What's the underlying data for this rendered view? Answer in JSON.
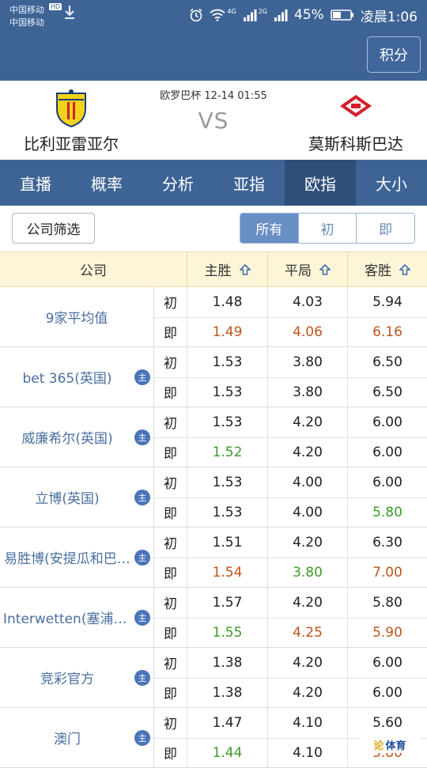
{
  "status": {
    "carrier1": "中国移动",
    "carrier2": "中国移动",
    "hd_badge": "HD",
    "battery": "45%",
    "time": "凌晨1:06",
    "net1": "4G",
    "net2": "2G"
  },
  "appbar": {
    "points_button": "积分"
  },
  "match": {
    "competition_time": "欧罗巴杯 12-14 01:55",
    "vs": "VS",
    "home": "比利亚雷亚尔",
    "away": "莫斯科斯巴达"
  },
  "tabs": [
    "直播",
    "概率",
    "分析",
    "亚指",
    "欧指",
    "大小"
  ],
  "active_tab": "欧指",
  "filter": {
    "company_filter": "公司筛选",
    "segments": [
      "所有",
      "初",
      "即"
    ],
    "active_segment": "所有"
  },
  "table": {
    "headers": {
      "company": "公司",
      "home": "主胜",
      "draw": "平局",
      "away": "客胜"
    },
    "kind_initial": "初",
    "kind_live": "即",
    "badge_text": "主",
    "rows": [
      {
        "company": "9家平均值",
        "badge": false,
        "initial": [
          "1.48",
          "4.03",
          "5.94"
        ],
        "live": [
          "1.49",
          "4.06",
          "6.16"
        ],
        "live_trend": [
          "up",
          "up",
          "up"
        ]
      },
      {
        "company": "bet 365(英国)",
        "badge": true,
        "initial": [
          "1.53",
          "3.80",
          "6.50"
        ],
        "live": [
          "1.53",
          "3.80",
          "6.50"
        ],
        "live_trend": [
          "",
          "",
          ""
        ]
      },
      {
        "company": "威廉希尔(英国)",
        "badge": true,
        "initial": [
          "1.53",
          "4.20",
          "6.00"
        ],
        "live": [
          "1.52",
          "4.20",
          "6.00"
        ],
        "live_trend": [
          "down",
          "",
          ""
        ]
      },
      {
        "company": "立博(英国)",
        "badge": true,
        "initial": [
          "1.53",
          "4.00",
          "6.00"
        ],
        "live": [
          "1.53",
          "4.00",
          "5.80"
        ],
        "live_trend": [
          "",
          "",
          "down"
        ]
      },
      {
        "company": "易胜博(安提瓜和巴…",
        "badge": true,
        "initial": [
          "1.51",
          "4.20",
          "6.30"
        ],
        "live": [
          "1.54",
          "3.80",
          "7.00"
        ],
        "live_trend": [
          "up",
          "down",
          "up"
        ]
      },
      {
        "company": "Interwetten(塞浦路…",
        "badge": true,
        "initial": [
          "1.57",
          "4.20",
          "5.80"
        ],
        "live": [
          "1.55",
          "4.25",
          "5.90"
        ],
        "live_trend": [
          "down",
          "up",
          "up"
        ]
      },
      {
        "company": "竞彩官方",
        "badge": true,
        "initial": [
          "1.38",
          "4.20",
          "6.00"
        ],
        "live": [
          "1.38",
          "4.20",
          "6.00"
        ],
        "live_trend": [
          "",
          "",
          ""
        ]
      },
      {
        "company": "澳门",
        "badge": true,
        "initial": [
          "1.47",
          "4.10",
          "5.60"
        ],
        "live": [
          "1.44",
          "4.10",
          "5.80"
        ],
        "live_trend": [
          "down",
          "",
          "up"
        ]
      }
    ]
  },
  "watermark": {
    "prefix": "论",
    "text": "体育"
  },
  "colors": {
    "header_blue": "#3e6496",
    "active_tab": "#2e4f7a",
    "rise": "#c0541c",
    "fall": "#3f9a2a",
    "table_header": "#fcf5d7"
  }
}
